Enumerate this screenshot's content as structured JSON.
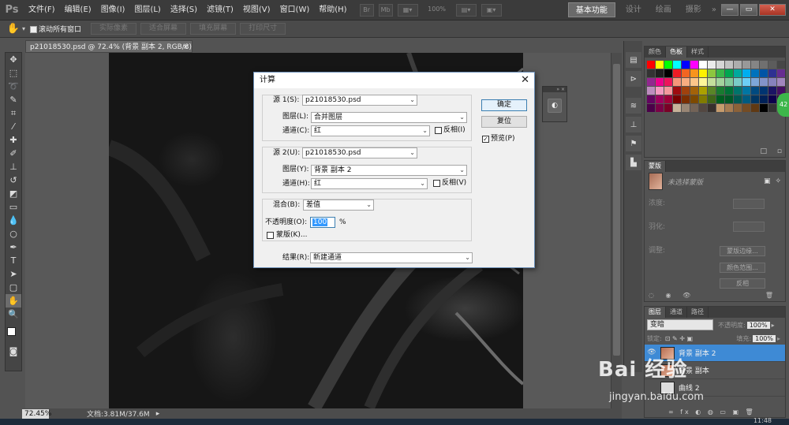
{
  "app": {
    "logo": "Ps"
  },
  "menu": [
    "文件(F)",
    "编辑(E)",
    "图像(I)",
    "图层(L)",
    "选择(S)",
    "滤镜(T)",
    "视图(V)",
    "窗口(W)",
    "帮助(H)"
  ],
  "menubar_controls": {
    "br": "Br",
    "mb": "Mb",
    "zoom": "100%"
  },
  "workspaces": [
    "基本功能",
    "设计",
    "绘画",
    "摄影"
  ],
  "workspace_more": "»",
  "window_controls": {
    "minimize": "—",
    "restore": "▭",
    "close": "✕"
  },
  "options": {
    "tool_dropdown": "▾",
    "scroll_all": "滚动所有窗口",
    "buttons": [
      "实际像素",
      "适合屏幕",
      "填充屏幕",
      "打印尺寸"
    ]
  },
  "document": {
    "tab_title": "p21018530.psd @ 72.4% (背景 副本 2, RGB/8) *",
    "close": "×"
  },
  "status": {
    "zoom": "72.45%",
    "doc_info": "文档:3.81M/37.6M",
    "arrow": "▸"
  },
  "taskbar": {
    "time": "11:48"
  },
  "dialog": {
    "title": "计算",
    "close": "✕",
    "source1": {
      "label": "源 1(S):",
      "file": "p21018530.psd",
      "layer_label": "图层(L):",
      "layer": "合并图层",
      "channel_label": "通道(C):",
      "channel": "红",
      "invert_label": "反相(I)",
      "invert": false
    },
    "source2": {
      "label": "源 2(U):",
      "file": "p21018530.psd",
      "layer_label": "图层(Y):",
      "layer": "背景 副本 2",
      "channel_label": "通道(H):",
      "channel": "红",
      "invert_label": "反相(V)",
      "invert": false
    },
    "blending": {
      "label": "混合(B):",
      "mode": "差值",
      "opacity_label": "不透明度(O):",
      "opacity": "100",
      "percent": "%",
      "mask_label": "蒙版(K)...",
      "mask": false
    },
    "result": {
      "label": "结果(R):",
      "value": "新建通道"
    },
    "buttons": {
      "ok": "确定",
      "reset": "复位"
    },
    "preview_label": "预览(P)",
    "preview": true,
    "dropdown_arrow": "⌄"
  },
  "swatch_panel": {
    "tabs": [
      "颜色",
      "色板",
      "样式"
    ],
    "active_tab": "色板",
    "footer_icons": [
      "□",
      "▫"
    ]
  },
  "masks_panel": {
    "tab": "蒙版",
    "status": "未选择蒙版",
    "density_label": "浓度:",
    "feather_label": "羽化:",
    "refine_label": "调整:",
    "buttons": [
      "蒙版边缘...",
      "颜色范围...",
      "反相"
    ]
  },
  "layers_panel": {
    "tabs": [
      "图层",
      "通道",
      "路径"
    ],
    "blend_mode": "变暗",
    "opacity_label": "不透明度:",
    "opacity": "100%",
    "lock_label": "锁定:",
    "lock_icons": "⊡ ✎ ✛ ▣",
    "fill_label": "填充:",
    "fill": "100%",
    "layers": [
      {
        "name": "背景 副本 2",
        "selected": true
      },
      {
        "name": "背景 副本",
        "selected": false
      },
      {
        "name": "曲线 2",
        "selected": false
      }
    ],
    "footer_icons": "∞ fx ◐ ◍ ▭ ▣ 🗑"
  },
  "badge": "42",
  "watermark": {
    "text": "Bai 经验",
    "url": "jingyan.baidu.com"
  },
  "colors": {
    "dialog_border": "#6b8fb8",
    "selected_layer": "#3e8ad5",
    "ok_border": "#3c7fb1",
    "badge": "#3db64a"
  }
}
